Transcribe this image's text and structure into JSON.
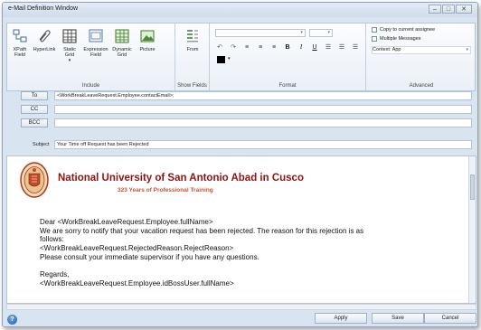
{
  "window": {
    "title": "e-Mail Definition Window"
  },
  "ribbon": {
    "include": {
      "label": "Include",
      "buttons": [
        {
          "label": "XPath Field",
          "icon": "xpath-field-icon"
        },
        {
          "label": "HyperLink",
          "icon": "hyperlink-icon"
        },
        {
          "label": "Static Grid",
          "icon": "static-grid-icon"
        },
        {
          "label": "Expression Field",
          "icon": "expression-field-icon"
        },
        {
          "label": "Dynamic Grid",
          "icon": "dynamic-grid-icon"
        },
        {
          "label": "Picture",
          "icon": "picture-icon"
        }
      ]
    },
    "show_fields": {
      "label": "Show Fields",
      "button_label": "From"
    },
    "format": {
      "label": "Format",
      "font_value": "",
      "size_value": ""
    },
    "advanced": {
      "label": "Advanced",
      "copy_to_assignee": "Copy to current assignee",
      "multiple_messages": "Multiple Messages",
      "context_value": "Context: App"
    }
  },
  "fields": {
    "to": {
      "label": "To",
      "value": "<WorkBreakLeaveRequest.Employee.contactEmail>;"
    },
    "cc": {
      "label": "CC",
      "value": ""
    },
    "bcc": {
      "label": "BCC",
      "value": ""
    },
    "subject": {
      "label": "Subject",
      "value": "Your Time off Request  has been Rejected"
    }
  },
  "message": {
    "university_name": "National University of San Antonio Abad in Cusco",
    "university_subtitle": "323 Years of Professional Training",
    "lines": [
      "Dear <WorkBreakLeaveRequest.Employee.fullName>",
      "We are sorry to notify that your vacation request has been rejected. The reason for this rejection is as",
      "follows:",
      "<WorkBreakLeaveRequest.RejectedReason.RejectReason>",
      "Please consult your immediate supervisor if you have any questions.",
      "",
      "Regards,",
      "<WorkBreakLeaveRequest.Employee.idBossUser.fullName>"
    ]
  },
  "footer": {
    "help": "?",
    "apply": "Apply",
    "save": "Save",
    "cancel": "Cancel"
  },
  "colors": {
    "accent": "#8b1414",
    "subtitle": "#c4553a",
    "window_bg": "#d9e4f1"
  }
}
